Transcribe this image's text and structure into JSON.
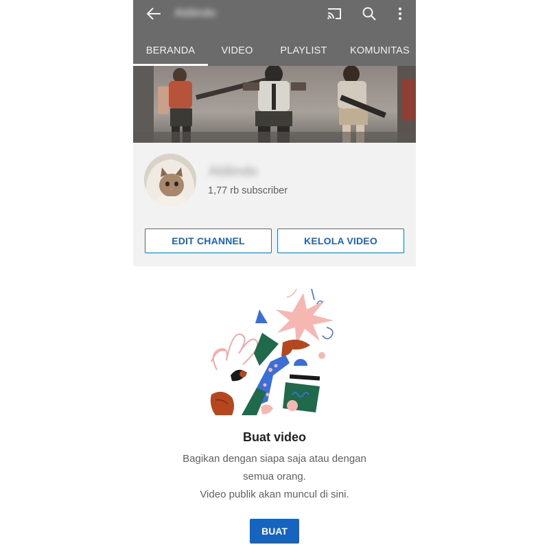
{
  "appbar": {
    "title": "Aldiindo",
    "icons": [
      "back-arrow-icon",
      "cast-icon",
      "search-icon",
      "more-vert-icon"
    ]
  },
  "tabs": [
    {
      "label": "BERANDA",
      "active": true
    },
    {
      "label": "VIDEO",
      "active": false
    },
    {
      "label": "PLAYLIST",
      "active": false
    },
    {
      "label": "KOMUNITAS",
      "active": false
    }
  ],
  "channel": {
    "name": "Aldiindo",
    "subscribers": "1,77 rb subscriber",
    "edit_button": "EDIT CHANNEL",
    "manage_button": "KELOLA VIDEO"
  },
  "empty_state": {
    "title": "Buat video",
    "description_lines": [
      "Bagikan dengan siapa saja atau dengan",
      "semua orang.",
      "Video publik akan muncul di sini."
    ],
    "button": "BUAT"
  },
  "colors": {
    "appbar": "#6b6b6b",
    "accent": "#1565c0",
    "channel_bg": "#f2f2f2"
  }
}
